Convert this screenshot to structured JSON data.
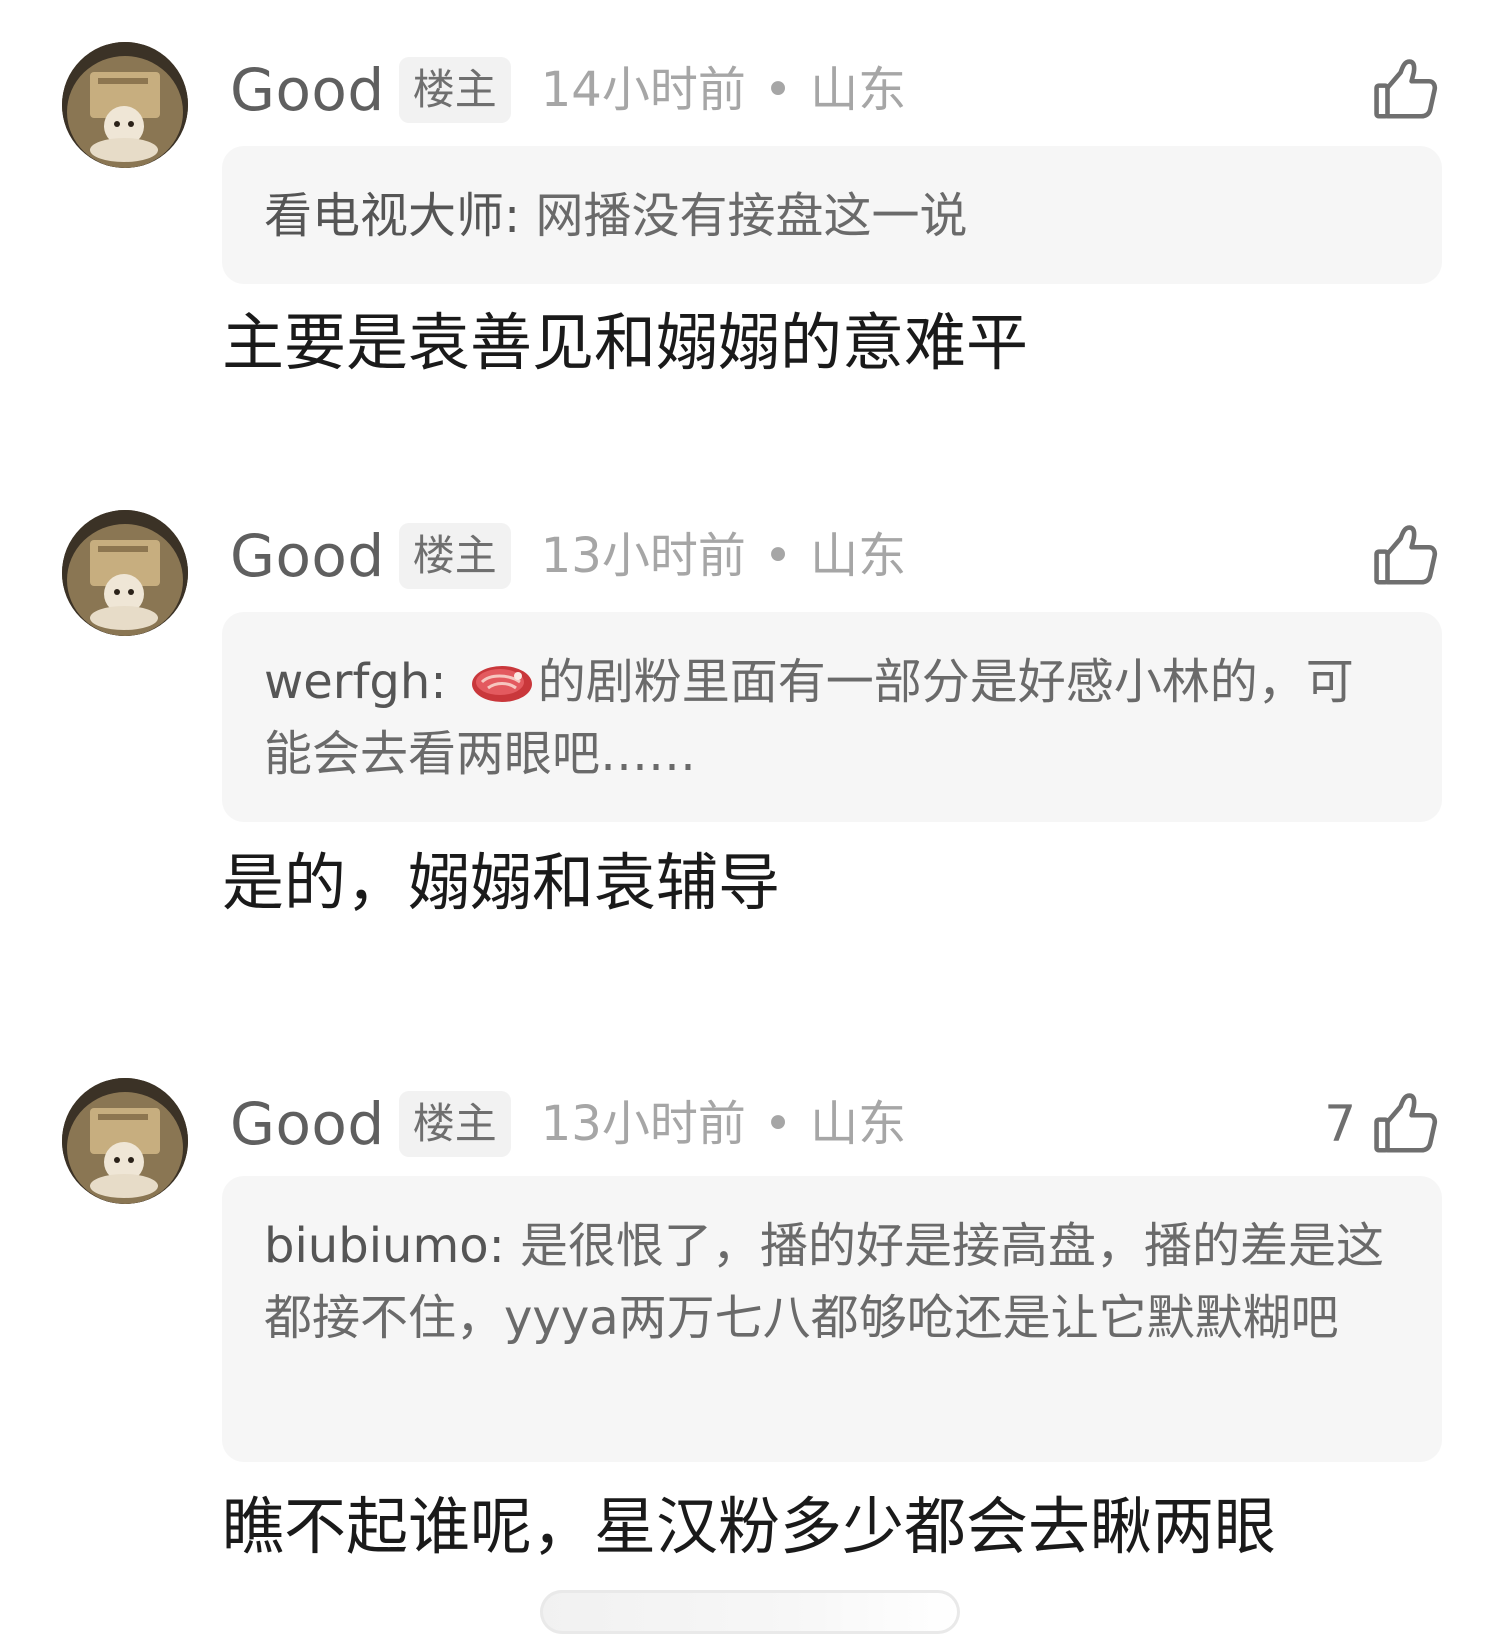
{
  "comments": [
    {
      "username": "Good",
      "badge": "楼主",
      "time": "14小时前",
      "dot": "•",
      "location": "山东",
      "likes": "",
      "quote": {
        "user": "看电视大师",
        "sep": ": ",
        "text": "网播没有接盘这一说"
      },
      "reply": "主要是袁善见和嫋嫋的意难平"
    },
    {
      "username": "Good",
      "badge": "楼主",
      "time": "13小时前",
      "dot": "•",
      "location": "山东",
      "likes": "",
      "quote": {
        "user": "werfgh",
        "sep": ": ",
        "emoji": "steak-emoji",
        "text": "的剧粉里面有一部分是好感小林的，可能会去看两眼吧……"
      },
      "reply": "是的，嫋嫋和袁辅导"
    },
    {
      "username": "Good",
      "badge": "楼主",
      "time": "13小时前",
      "dot": "•",
      "location": "山东",
      "likes": "7",
      "quote": {
        "user": "biubiumo",
        "sep": ": ",
        "text": "是很恨了，播的好是接高盘，播的差是这都接不住，yyya两万七八都够呛还是让它默默糊吧"
      },
      "reply": "瞧不起谁呢，星汉粉多少都会去瞅两眼"
    }
  ],
  "icons": {
    "like": "thumbs-up-icon",
    "avatar": "avatar-image"
  },
  "colors": {
    "quote_bg": "#f6f6f6",
    "meta_gray": "#a6a6a6",
    "text_dark": "#1a1a1a"
  }
}
